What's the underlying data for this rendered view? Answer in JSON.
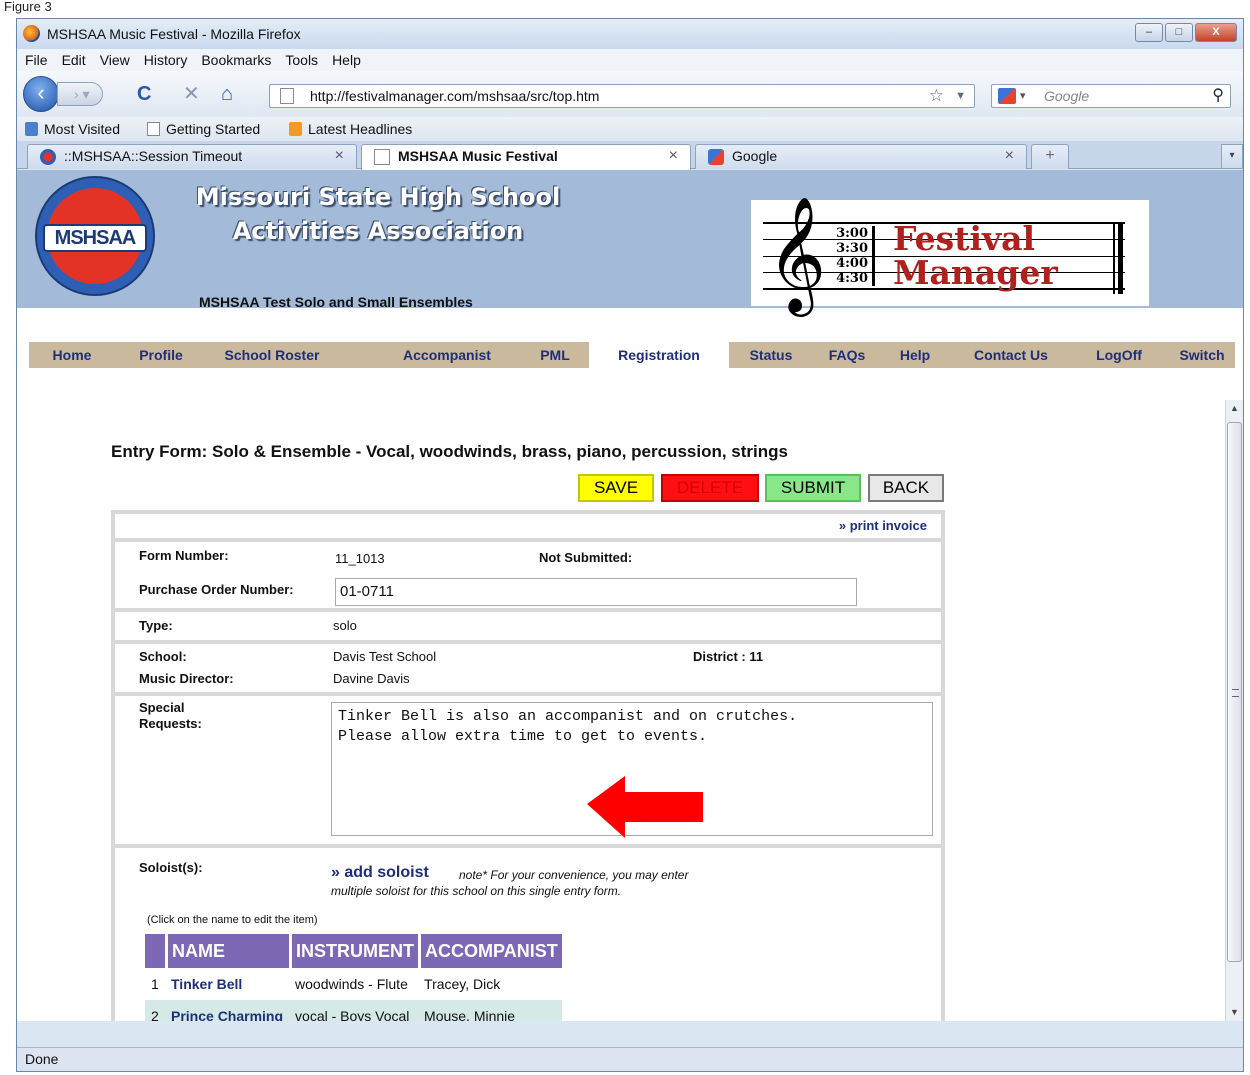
{
  "caption": "Figure 3",
  "window": {
    "title": "MSHSAA Music Festival - Mozilla Firefox",
    "min": "–",
    "max": "□",
    "close": "X"
  },
  "menu": [
    "File",
    "Edit",
    "View",
    "History",
    "Bookmarks",
    "Tools",
    "Help"
  ],
  "navbar": {
    "url": "http://festivalmanager.com/mshsaa/src/top.htm",
    "search_placeholder": "Google"
  },
  "bookmarks": [
    "Most Visited",
    "Getting Started",
    "Latest Headlines"
  ],
  "tabs": [
    {
      "label": "::MSHSAA::Session Timeout"
    },
    {
      "label": "MSHSAA Music Festival"
    },
    {
      "label": "Google"
    }
  ],
  "banner": {
    "seal_text": "MSHSAA",
    "org_line1": "Missouri State High School",
    "org_line2": "Activities Association",
    "event_name": "MSHSAA Test Solo and Small Ensembles",
    "fm_times": [
      "3:00",
      "3:30",
      "4:00",
      "4:30"
    ],
    "fm_title1": "Festival",
    "fm_title2": "Manager"
  },
  "mainnav": [
    "Home",
    "Profile",
    "School Roster",
    "Accompanist",
    "PML",
    "Registration",
    "Status",
    "FAQs",
    "Help",
    "Contact Us",
    "LogOff",
    "Switch"
  ],
  "form": {
    "title": "Entry Form: Solo & Ensemble - Vocal, woodwinds, brass, piano, percussion, strings",
    "buttons": {
      "save": "SAVE",
      "delete": "DELETE",
      "submit": "SUBMIT",
      "back": "BACK"
    },
    "print_invoice": "» print invoice",
    "form_number_label": "Form Number:",
    "form_number": "11_1013",
    "status": "Not Submitted:",
    "po_label": "Purchase Order Number:",
    "po_value": "01-0711",
    "type_label": "Type:",
    "type_value": "solo",
    "school_label": "School:",
    "school_value": "Davis Test School",
    "district_label": "District : 11",
    "director_label": "Music Director:",
    "director_value": "Davine Davis",
    "special_label_1": "Special",
    "special_label_2": "Requests:",
    "special_text": "Tinker Bell is also an accompanist and on crutches.\nPlease allow extra time to get to events.",
    "soloists_label": "Soloist(s):",
    "add_soloist": "» add soloist",
    "add_note_1": "note* For your convenience, you may enter",
    "add_note_2": "multiple soloist for this school on this single entry form.",
    "click_note": "(Click on the name to edit the item)",
    "table_headers": [
      "NAME",
      "INSTRUMENT",
      "ACCOMPANIST"
    ],
    "rows": [
      {
        "num": "1",
        "name": "Tinker Bell",
        "instrument": "woodwinds - Flute",
        "accompanist": "Tracey, Dick"
      },
      {
        "num": "2",
        "name": "Prince Charming",
        "instrument": "vocal - Boys Vocal",
        "accompanist": "Mouse, Minnie"
      }
    ]
  },
  "colors": {
    "arrow": "#ff0000",
    "nav_bg": "#cbb99d",
    "banner_bg": "#a3bad8",
    "header_purple": "#7c68b4"
  },
  "status_bar": "Done"
}
